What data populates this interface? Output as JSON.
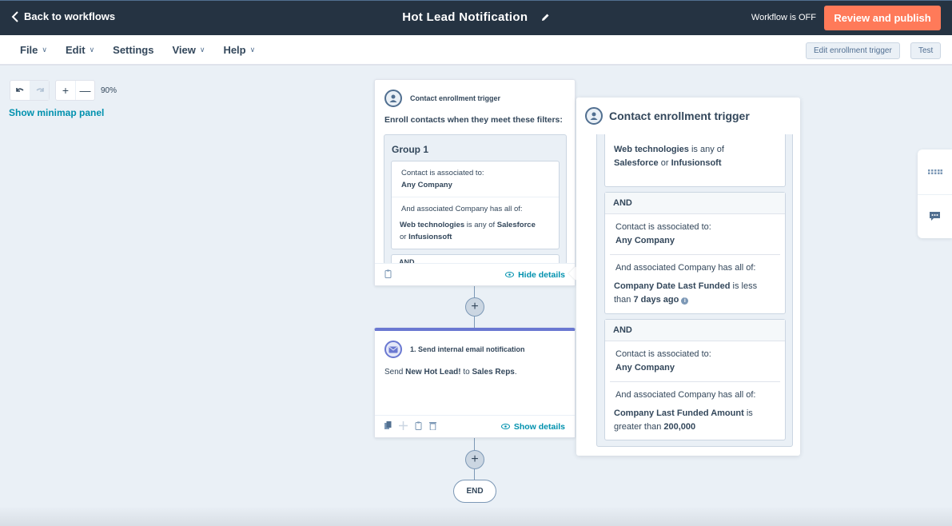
{
  "topbar": {
    "back_label": "Back to workflows",
    "title": "Hot Lead Notification",
    "status": "Workflow is OFF",
    "publish_label": "Review and publish",
    "publish_color": "#ff7a59"
  },
  "menubar": {
    "items": [
      {
        "label": "File",
        "dropdown": true
      },
      {
        "label": "Edit",
        "dropdown": true
      },
      {
        "label": "Settings",
        "dropdown": false
      },
      {
        "label": "View",
        "dropdown": true
      },
      {
        "label": "Help",
        "dropdown": true
      }
    ],
    "edit_trigger_label": "Edit enrollment trigger",
    "test_label": "Test"
  },
  "canvas": {
    "zoom_level": "90%",
    "minimap_label": "Show minimap panel"
  },
  "trigger_card": {
    "label": "Contact enrollment trigger",
    "enroll_text": "Enroll contacts when they meet these filters:",
    "group_title": "Group 1",
    "filter": {
      "assoc_text": "Contact is associated to:",
      "assoc_value": "Any Company",
      "has_all_text": "And associated Company has all of:",
      "prop": "Web technologies",
      "op": " is any of ",
      "v1": "Salesforce",
      "or": " or ",
      "v2": "Infusionsoft"
    },
    "and_peek": "AND",
    "hide_details_label": "Hide details"
  },
  "action_card": {
    "label": "1. Send internal email notification",
    "text_pre": "Send ",
    "email_name": "New Hot Lead!",
    "text_mid": " to ",
    "recipient": "Sales Reps",
    "text_end": ".",
    "show_details_label": "Show details",
    "accent_color": "#6a78d1"
  },
  "end_label": "END",
  "panel": {
    "title": "Contact enrollment trigger",
    "filters": [
      {
        "cut_text": "And associated Company has all of:",
        "prop": "Web technologies",
        "op": " is any of ",
        "v1": "Salesforce",
        "or": " or ",
        "v2": "Infusionsoft"
      },
      {
        "and_label": "AND",
        "assoc_text": "Contact is associated to:",
        "assoc_value": "Any Company",
        "has_all_text": "And associated Company has all of:",
        "prop": "Company Date Last Funded",
        "op": " is less than ",
        "value": "7 days ago"
      },
      {
        "and_label": "AND",
        "assoc_text": "Contact is associated to:",
        "assoc_value": "Any Company",
        "has_all_text": "And associated Company has all of:",
        "prop": "Company Last Funded Amount",
        "op": " is greater than ",
        "value": "200,000"
      }
    ]
  },
  "sidetab": {
    "icons": [
      "keyboard-shortcuts-icon",
      "chat-icon"
    ]
  }
}
